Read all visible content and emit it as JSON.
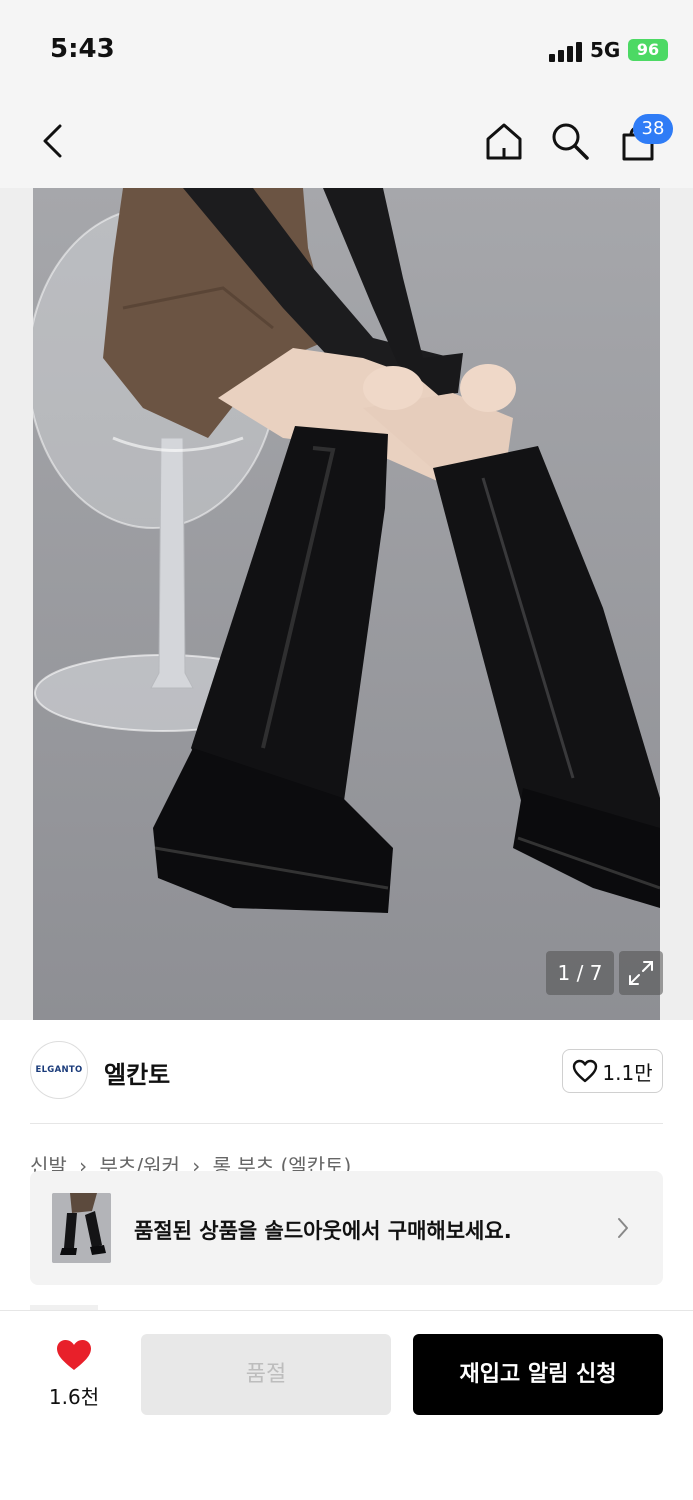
{
  "status_bar": {
    "time": "5:43",
    "network": "5G",
    "battery": "96"
  },
  "nav": {
    "cart_count": "38"
  },
  "product_image": {
    "counter": "1 / 7"
  },
  "brand": {
    "logo_text": "ELGANTO",
    "name": "엘칸토",
    "like_count": "1.1만"
  },
  "breadcrumb": [
    "신발",
    "부츠/워커",
    "롱 부츠 (엘칸토)"
  ],
  "soldout_banner": {
    "text": "품절된 상품을 솔드아웃에서 구매해보세요."
  },
  "bottom_bar": {
    "wish_count": "1.6천",
    "soldout_label": "품절",
    "restock_label": "재입고 알림 신청"
  },
  "colors": {
    "accent_blue": "#2f7cf6",
    "battery_green": "#4cd964",
    "heart_red": "#e8202a",
    "primary_black": "#000000"
  }
}
